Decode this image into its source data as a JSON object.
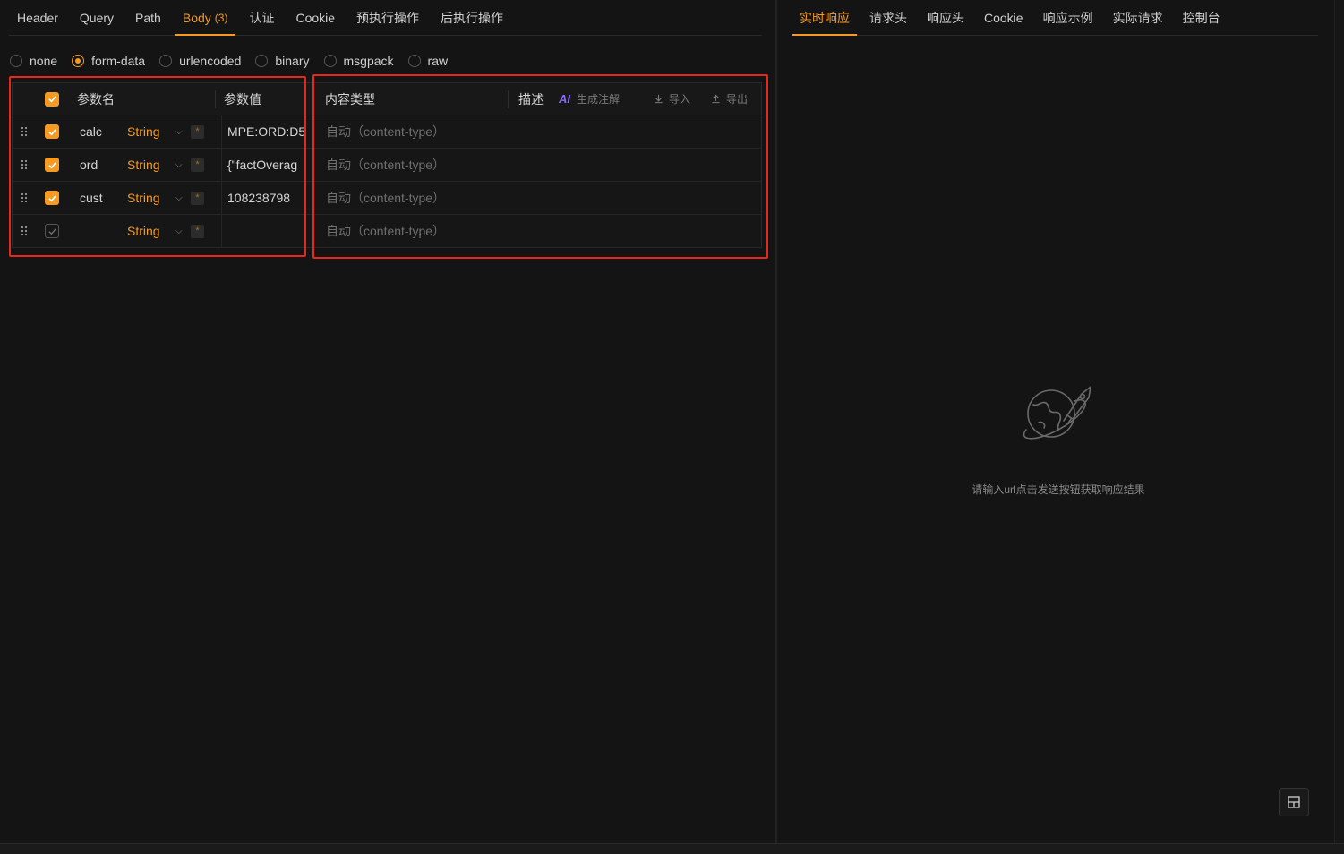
{
  "request_tabs": [
    {
      "label": "Header"
    },
    {
      "label": "Query"
    },
    {
      "label": "Path"
    },
    {
      "label": "Body",
      "badge": "(3)",
      "active": true
    },
    {
      "label": "认证"
    },
    {
      "label": "Cookie"
    },
    {
      "label": "预执行操作"
    },
    {
      "label": "后执行操作"
    }
  ],
  "body_types": [
    {
      "label": "none",
      "checked": false
    },
    {
      "label": "form-data",
      "checked": true
    },
    {
      "label": "urlencoded",
      "checked": false
    },
    {
      "label": "binary",
      "checked": false
    },
    {
      "label": "msgpack",
      "checked": false
    },
    {
      "label": "raw",
      "checked": false
    }
  ],
  "table": {
    "headers": {
      "name": "参数名",
      "value": "参数值",
      "content_type": "内容类型",
      "description": "描述"
    },
    "toolbar": {
      "ai_label": "AI",
      "generate_label": "生成注解",
      "import_label": "导入",
      "export_label": "导出"
    },
    "rows": [
      {
        "checked": true,
        "name": "calc",
        "type": "String",
        "required_mark": "*",
        "value": "MPE:ORD:D5",
        "content_type_placeholder": "自动（content-type）"
      },
      {
        "checked": true,
        "name": "ord",
        "type": "String",
        "required_mark": "*",
        "value": "{\"factOverag",
        "content_type_placeholder": "自动（content-type）"
      },
      {
        "checked": true,
        "name": "cust",
        "type": "String",
        "required_mark": "*",
        "value": "108238798",
        "content_type_placeholder": "自动（content-type）"
      },
      {
        "checked": false,
        "name": "",
        "type": "String",
        "required_mark": "*",
        "value": "",
        "content_type_placeholder": "自动（content-type）"
      }
    ]
  },
  "response_tabs": [
    {
      "label": "实时响应",
      "active": true
    },
    {
      "label": "请求头"
    },
    {
      "label": "响应头"
    },
    {
      "label": "Cookie"
    },
    {
      "label": "响应示例"
    },
    {
      "label": "实际请求"
    },
    {
      "label": "控制台"
    }
  ],
  "empty_state": {
    "icon": "planet-rocket-icon",
    "message": "请输入url点击发送按钮获取响应结果"
  },
  "colors": {
    "accent": "#f59a23",
    "highlight_box": "#e8261b",
    "background": "#141414",
    "ai_purple": "#8b6cf6"
  }
}
